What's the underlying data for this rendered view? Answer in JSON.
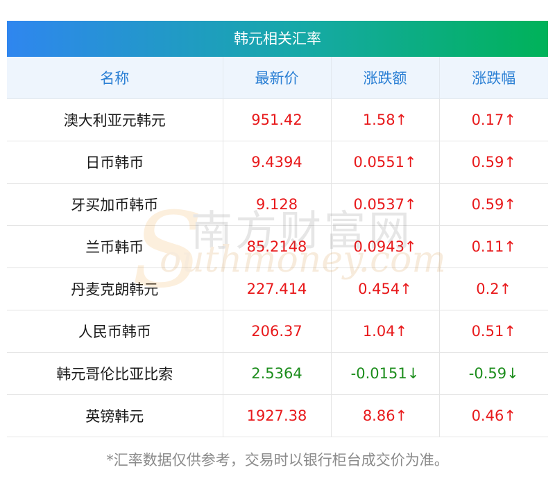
{
  "title": "韩元相关汇率",
  "headers": [
    "名称",
    "最新价",
    "涨跌额",
    "涨跌幅"
  ],
  "rows": [
    {
      "name": "澳大利亚元韩元",
      "price": "951.42",
      "change": "1.58↑",
      "pct": "0.17↑",
      "dir": "up"
    },
    {
      "name": "日币韩币",
      "price": "9.4394",
      "change": "0.0551↑",
      "pct": "0.59↑",
      "dir": "up"
    },
    {
      "name": "牙买加币韩币",
      "price": "9.128",
      "change": "0.0537↑",
      "pct": "0.59↑",
      "dir": "up"
    },
    {
      "name": "兰币韩币",
      "price": "85.2148",
      "change": "0.0943↑",
      "pct": "0.11↑",
      "dir": "up"
    },
    {
      "name": "丹麦克朗韩元",
      "price": "227.414",
      "change": "0.454↑",
      "pct": "0.2↑",
      "dir": "up"
    },
    {
      "name": "人民币韩币",
      "price": "206.37",
      "change": "1.04↑",
      "pct": "0.51↑",
      "dir": "up"
    },
    {
      "name": "韩元哥伦比亚比索",
      "price": "2.5364",
      "change": "-0.0151↓",
      "pct": "-0.59↓",
      "dir": "down"
    },
    {
      "name": "英镑韩元",
      "price": "1927.38",
      "change": "8.86↑",
      "pct": "0.46↑",
      "dir": "up"
    }
  ],
  "footnote": "*汇率数据仅供参考，交易时以银行柜台成交价为准。",
  "watermark": {
    "cn": "南方财富网",
    "en": "outhmoney.com",
    "s": "S"
  },
  "colors": {
    "up": "#e8191b",
    "down": "#1c8d1c",
    "header_text": "#2a7fd4",
    "gradient_start": "#2f86ef",
    "gradient_end": "#00b259"
  }
}
